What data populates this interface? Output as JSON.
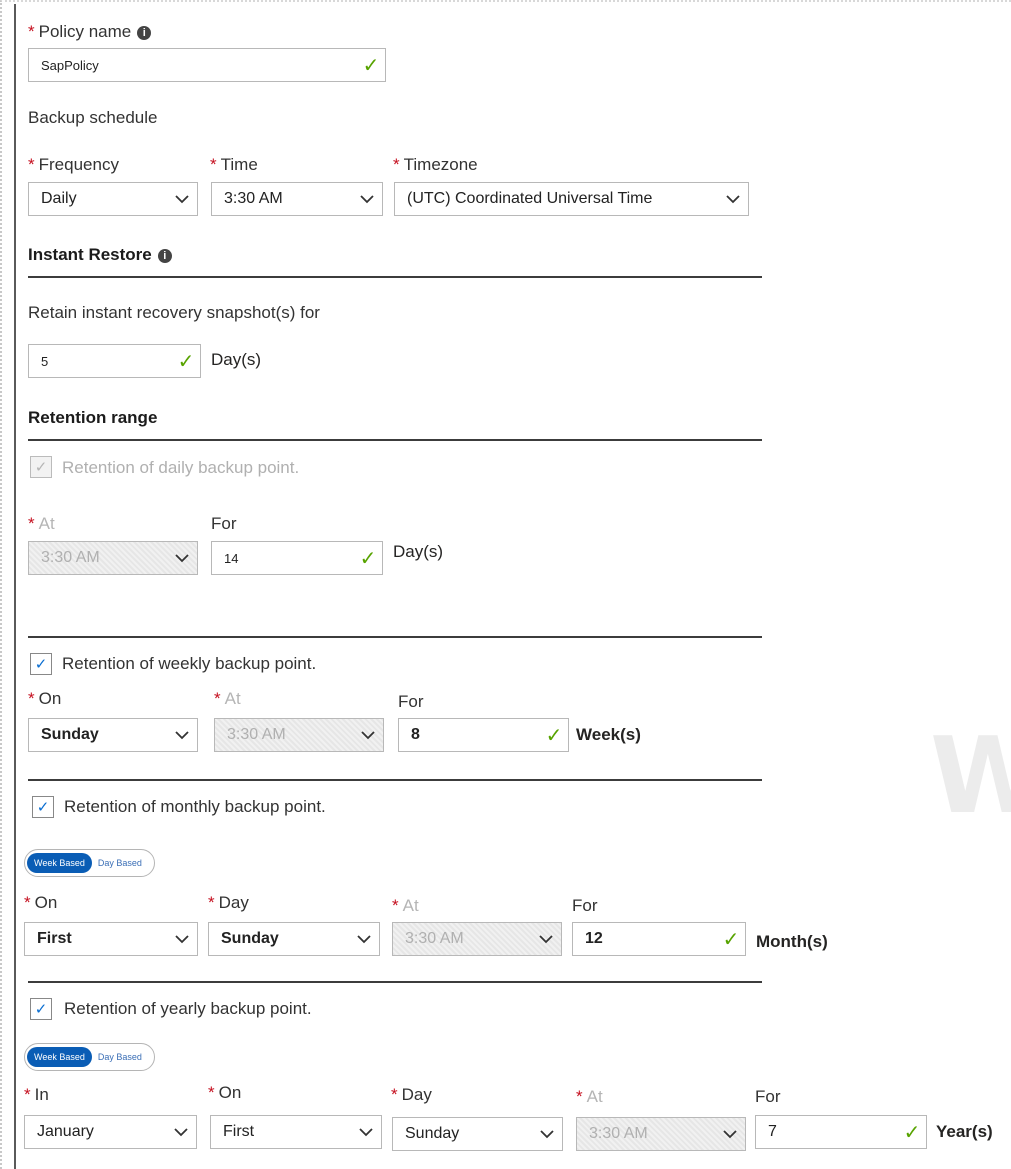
{
  "policy": {
    "label": "Policy name",
    "value": "SapPolicy"
  },
  "backup_schedule": {
    "heading": "Backup schedule",
    "frequency_label": "Frequency",
    "frequency_value": "Daily",
    "time_label": "Time",
    "time_value": "3:30 AM",
    "timezone_label": "Timezone",
    "timezone_value": "(UTC) Coordinated Universal Time"
  },
  "instant_restore": {
    "heading": "Instant Restore",
    "retain_label": "Retain instant recovery snapshot(s) for",
    "retain_value": "5",
    "unit": "Day(s)"
  },
  "retention_range": {
    "heading": "Retention range",
    "daily": {
      "checkbox_label": "Retention of daily backup point.",
      "checked": true,
      "at_label": "At",
      "at_value": "3:30 AM",
      "for_label": "For",
      "for_value": "14",
      "unit": "Day(s)"
    },
    "weekly": {
      "checkbox_label": "Retention of weekly backup point.",
      "checked": true,
      "on_label": "On",
      "on_value": "Sunday",
      "at_label": "At",
      "at_value": "3:30 AM",
      "for_label": "For",
      "for_value": "8",
      "unit": "Week(s)"
    },
    "monthly": {
      "checkbox_label": "Retention of monthly backup point.",
      "checked": true,
      "toggle_on": "Week Based",
      "toggle_off": "Day Based",
      "on_label": "On",
      "on_value": "First",
      "day_label": "Day",
      "day_value": "Sunday",
      "at_label": "At",
      "at_value": "3:30 AM",
      "for_label": "For",
      "for_value": "12",
      "unit": "Month(s)"
    },
    "yearly": {
      "checkbox_label": "Retention of yearly backup point.",
      "checked": true,
      "toggle_on": "Week Based",
      "toggle_off": "Day Based",
      "in_label": "In",
      "in_value": "January",
      "on_label": "On",
      "on_value": "First",
      "day_label": "Day",
      "day_value": "Sunday",
      "at_label": "At",
      "at_value": "3:30 AM",
      "for_label": "For",
      "for_value": "7",
      "unit": "Year(s)"
    }
  },
  "watermark": "W",
  "icons": {
    "info": "info-icon",
    "valid": "checkmark-valid-icon",
    "dropdown": "chevron-down-icon",
    "checkbox": "checkbox-checked-icon"
  },
  "colors": {
    "required": "#c50f1f",
    "valid": "#57a300",
    "toggle_active": "#0a5db5",
    "checkbox_tick": "#0a6ed1"
  }
}
